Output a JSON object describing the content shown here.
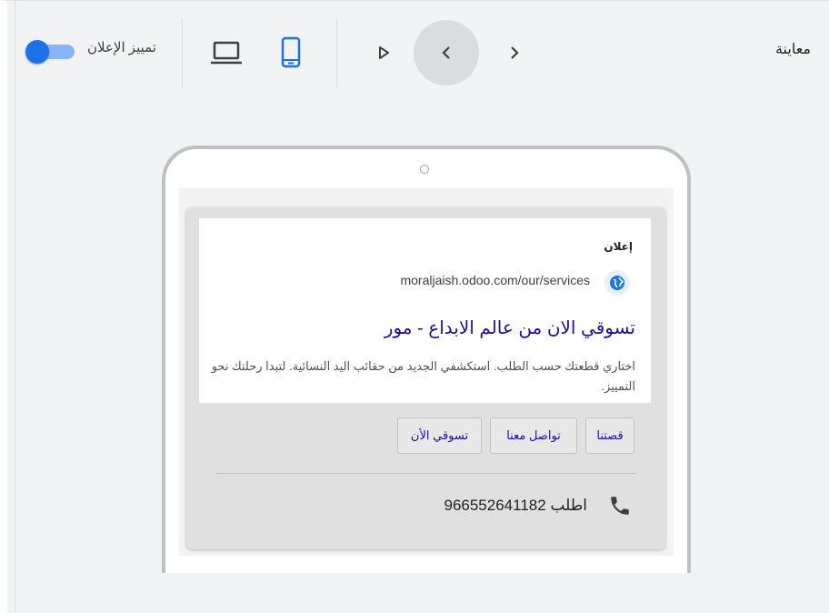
{
  "header": {
    "title": "معاينة",
    "highlight_label": "تمييز الإعلان",
    "highlight_enabled": true,
    "selected_device": "mobile",
    "icons": {
      "play": "play-icon",
      "prev": "chevron-left-icon",
      "next": "chevron-right-icon",
      "mobile": "smartphone-icon",
      "desktop": "laptop-icon"
    }
  },
  "ad": {
    "label": "إعلان",
    "url": "moraljaish.odoo.com/our/services",
    "headline": "تسوقي الان من عالم الابداع - مور",
    "description": "اختاري قطعتك حسب الطلب. استكشفي الجديد من حقائب اليد النسائية. لتبدا رحلتك نحو التمييز.",
    "sitelinks": [
      "قصتنا",
      "تواصل معنا",
      "تسوقي الأن"
    ],
    "call_text": "اطلب 966552641182"
  },
  "colors": {
    "accent": "#1a73e8",
    "headline": "#1a0dab",
    "toggle_track": "#8ab4f8"
  }
}
